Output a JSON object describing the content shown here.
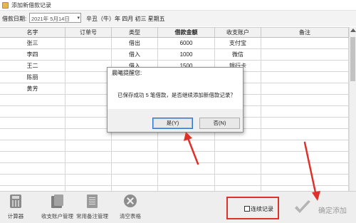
{
  "window": {
    "title": "添加新借款记录"
  },
  "toolbar": {
    "date_label": "借款日期:",
    "date_value": "2021年 5月14日",
    "dropdown_glyph": "▾",
    "lunar_text": "辛丑（牛）年 四月 初三 星期五"
  },
  "table": {
    "columns": [
      "名字",
      "订单号",
      "类型",
      "借款金额",
      "收支账户",
      "备注"
    ],
    "rows": [
      [
        "张三",
        "",
        "借出",
        "6000",
        "支付宝",
        ""
      ],
      [
        "李四",
        "",
        "借入",
        "1000",
        "微信",
        ""
      ],
      [
        "王二",
        "",
        "借入",
        "1500",
        "银行卡",
        ""
      ],
      [
        "陈丽",
        "",
        "",
        "",
        "",
        ""
      ],
      [
        "黄芳",
        "",
        "",
        "",
        "",
        ""
      ]
    ]
  },
  "dialog": {
    "title": "晨曦提醒您:",
    "message": "已保存成功 5 笔借款，是否继续添加新借款记录？",
    "yes_label": "是(Y)",
    "no_label": "否(N)"
  },
  "bottom": {
    "calculator_label": "计算器",
    "account_label": "收支账户管理",
    "notes_label": "常用备注管理",
    "clear_label": "清空表格",
    "continuous_label": "连续记录",
    "continuous_checked": false,
    "confirm_label": "确定添加"
  },
  "icons": {
    "app": "app-icon",
    "calculator": "calculator-icon",
    "account": "folder-icon",
    "notes": "document-icon",
    "clear": "clear-circle-x-icon",
    "confirm": "checkmark-icon"
  },
  "colors": {
    "annotation": "#e0302a",
    "default_button_border": "#2f74c9",
    "disabled_text": "#9a9a9a"
  }
}
